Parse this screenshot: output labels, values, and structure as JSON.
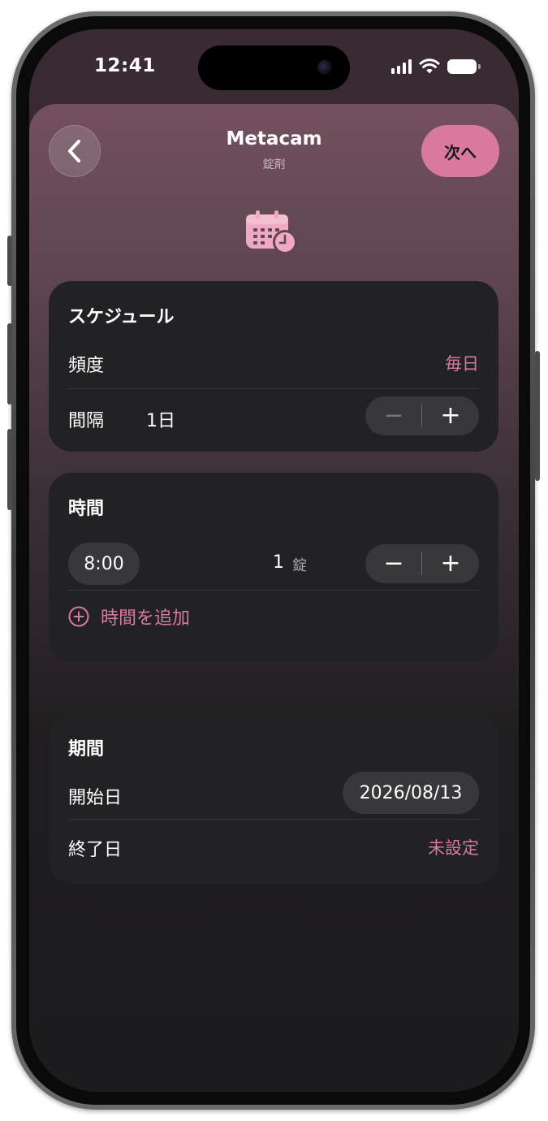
{
  "status_bar": {
    "time": "12:41"
  },
  "nav": {
    "title": "Metacam",
    "subtitle": "錠剤",
    "next_label": "次へ",
    "back_icon": "chevron-left-icon"
  },
  "header_icon": "calendar-clock-icon",
  "schedule": {
    "title": "スケジュール",
    "frequency_label": "頻度",
    "frequency_value": "毎日",
    "interval_label": "間隔",
    "interval_value": "1日",
    "minus_symbol": "−",
    "plus_symbol": "+"
  },
  "time_section": {
    "title": "時間",
    "entries": [
      {
        "time": "8:00",
        "quantity": "1",
        "unit": "錠"
      }
    ],
    "minus_symbol": "−",
    "plus_symbol": "+",
    "add_label": "時間を追加"
  },
  "period": {
    "title": "期間",
    "start_label": "開始日",
    "start_value": "2026/08/13",
    "end_label": "終了日",
    "end_value": "未設定"
  },
  "colors": {
    "accent": "#d97a9d",
    "card": "#222124",
    "background": "#1c1c1e",
    "control": "#38373a"
  }
}
